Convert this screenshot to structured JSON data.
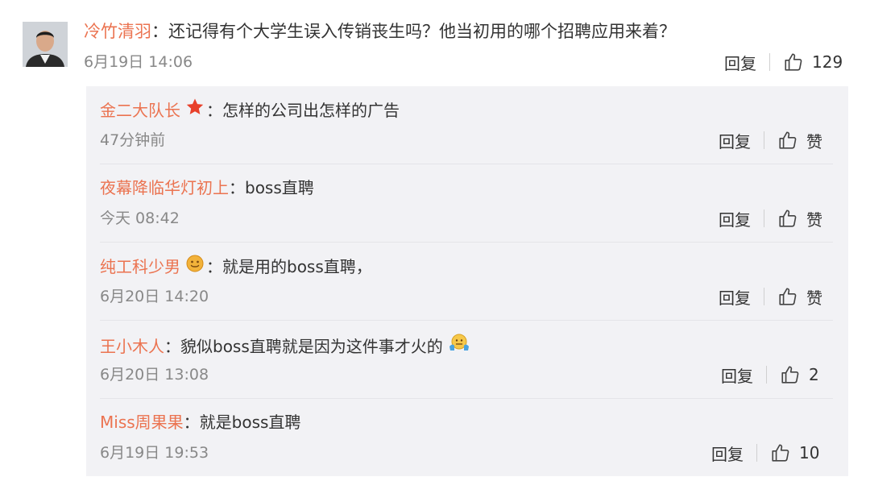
{
  "main_comment": {
    "username": "冷竹清羽",
    "text": "还记得有个大学生误入传销丧生吗？他当初用的哪个招聘应用来着？",
    "time": "6月19日 14:06",
    "reply_label": "回复",
    "likes": "129"
  },
  "sub_comments": [
    {
      "username": "金二大队长",
      "badge": "star-badge-icon",
      "text": "怎样的公司出怎样的广告",
      "time": "47分钟前",
      "reply_label": "回复",
      "likes": "赞"
    },
    {
      "username": "夜幕降临华灯初上",
      "text": "boss直聘",
      "time": "今天 08:42",
      "reply_label": "回复",
      "likes": "赞"
    },
    {
      "username": "纯工科少男",
      "badge": "smiley-badge-icon",
      "text": "就是用的boss直聘，",
      "time": "6月20日 14:20",
      "reply_label": "回复",
      "likes": "赞"
    },
    {
      "username": "王小木人",
      "text": "貌似boss直聘就是因为这件事才火的",
      "emoji": "shrug-emoji-icon",
      "time": "6月20日 13:08",
      "reply_label": "回复",
      "likes": "2"
    },
    {
      "username": "Miss周果果",
      "text": "就是boss直聘",
      "time": "6月19日 19:53",
      "reply_label": "回复",
      "likes": "10"
    }
  ],
  "colors": {
    "username": "#eb7350",
    "text": "#333333",
    "time": "#888888",
    "panel_bg": "#f2f2f5"
  }
}
